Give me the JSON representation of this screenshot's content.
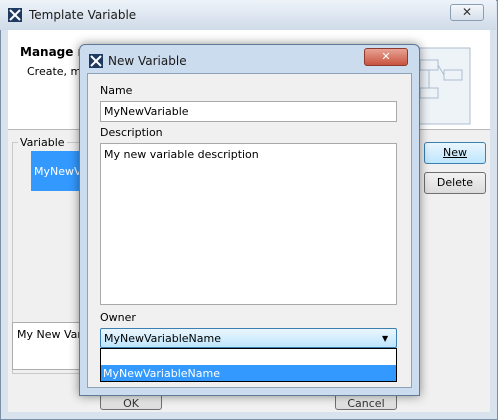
{
  "background_window": {
    "title": "Template Variable",
    "close_glyph": "✕",
    "header_title": "Manage re",
    "header_subtitle": "Create, mo",
    "variable_group_label": "Variable",
    "variable_item": "MyNewVaria",
    "description_preview": "My New Varia",
    "new_button": "New",
    "delete_button": "Delete",
    "ok_button": "OK",
    "cancel_button": "Cancel"
  },
  "dialog": {
    "title": "New Variable",
    "close_glyph": "✕",
    "name_label": "Name",
    "name_value": "MyNewVariable",
    "description_label": "Description",
    "description_value": "My new variable description",
    "owner_label": "Owner",
    "owner_selected": "MyNewVariableName",
    "owner_arrow": "▼",
    "owner_options": [
      "",
      "MyNewVariableName"
    ]
  }
}
